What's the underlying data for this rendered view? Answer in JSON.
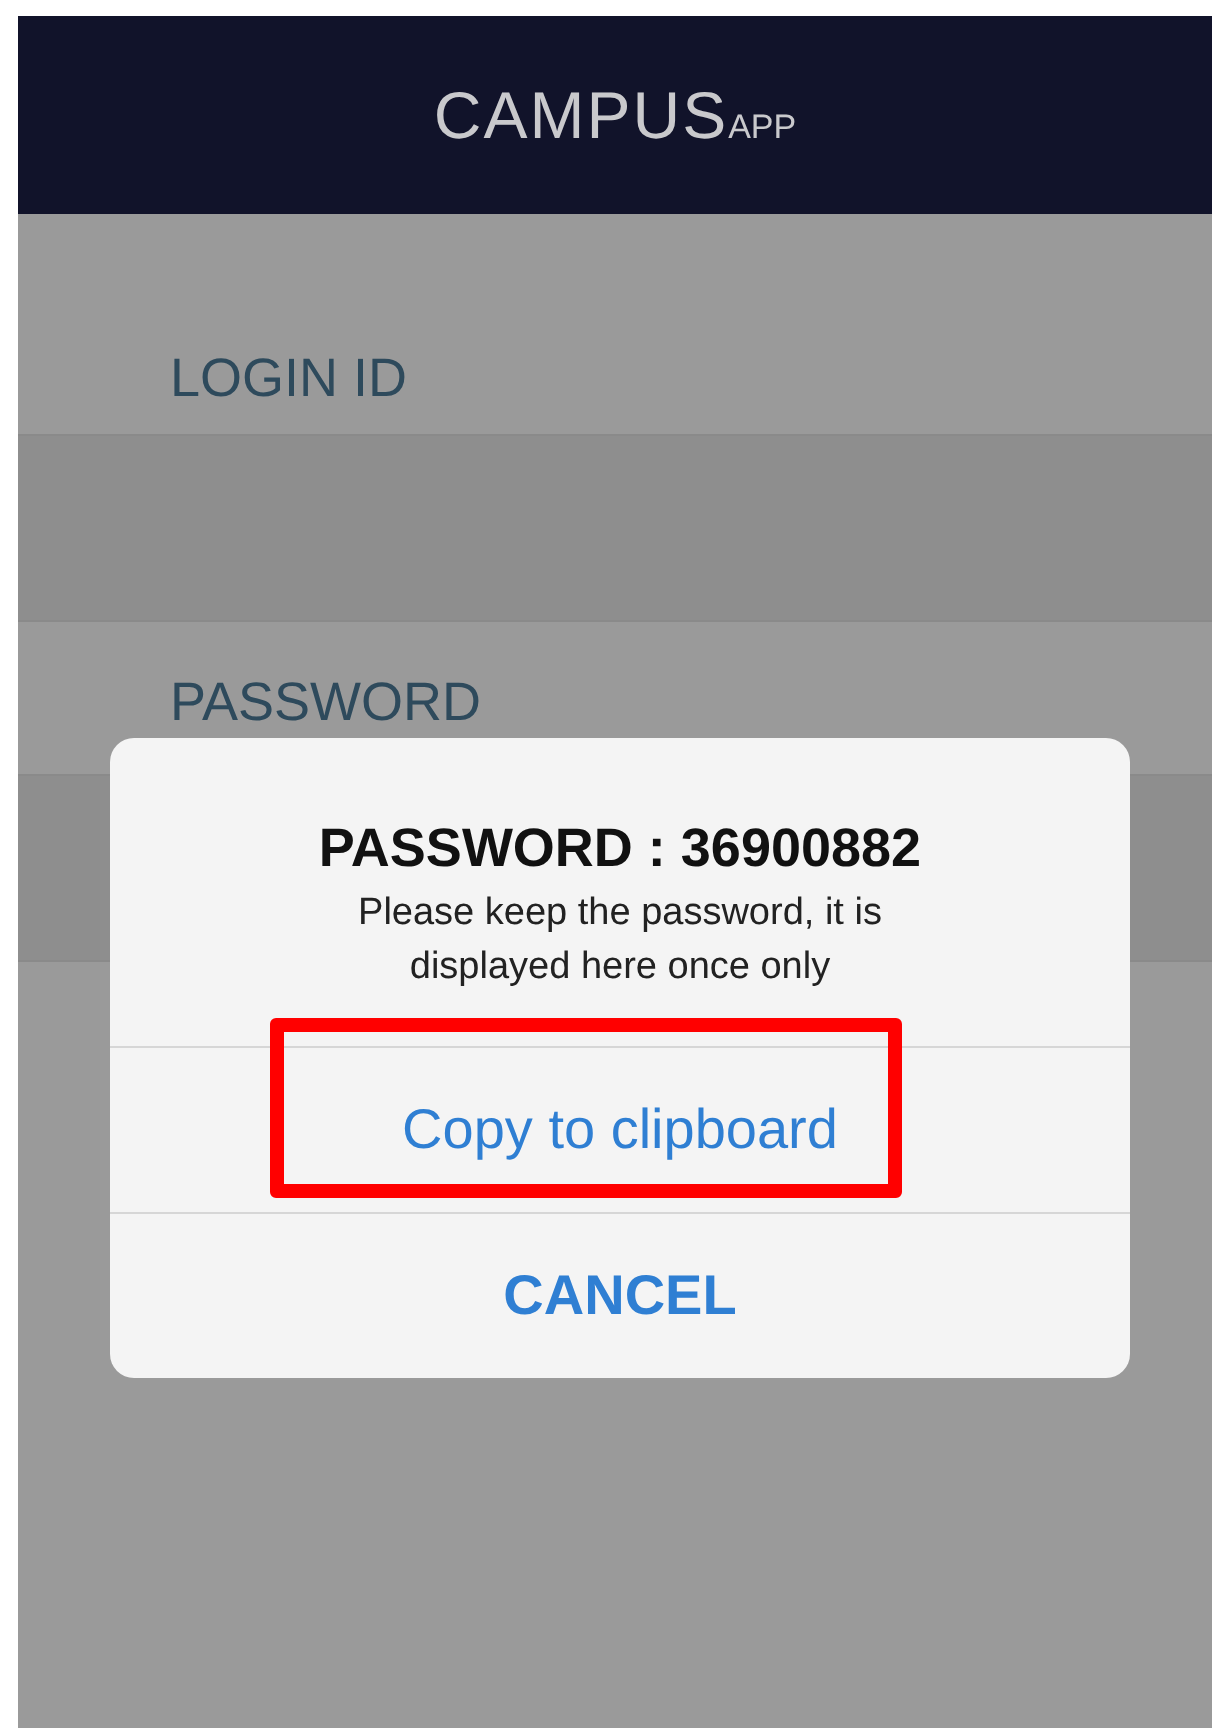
{
  "header": {
    "logo": {
      "name": "CAMPUS",
      "suffix": "APP"
    }
  },
  "form": {
    "fields": [
      {
        "label": "LOGIN ID"
      },
      {
        "label": "PASSWORD"
      }
    ]
  },
  "dialog": {
    "title": "PASSWORD : 36900882",
    "message": "Please keep the password, it is displayed here once only",
    "actions": [
      {
        "label": "Copy to clipboard",
        "kind": "plain",
        "highlighted": true
      },
      {
        "label": "CANCEL",
        "kind": "bold",
        "highlighted": false
      }
    ]
  }
}
